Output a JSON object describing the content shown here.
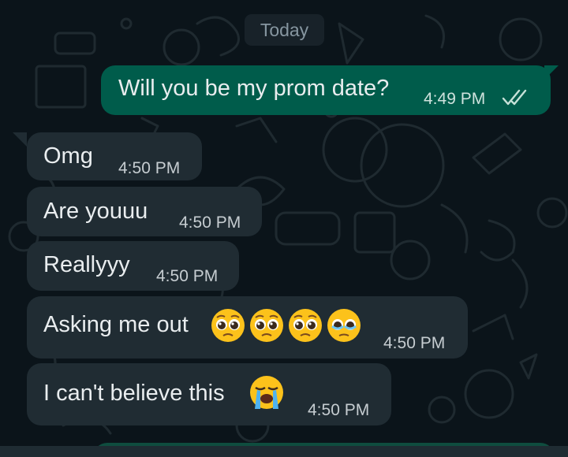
{
  "date_chip": "Today",
  "messages": [
    {
      "direction": "outgoing",
      "text": "Will you be my prom date?",
      "time": "4:49 PM",
      "status": "read"
    },
    {
      "direction": "incoming",
      "text": "Omg",
      "time": "4:50 PM"
    },
    {
      "direction": "incoming",
      "text": "Are youuu",
      "time": "4:50 PM"
    },
    {
      "direction": "incoming",
      "text": "Reallyyy",
      "time": "4:50 PM"
    },
    {
      "direction": "incoming",
      "text": "Asking me out",
      "emojis": [
        "pleading-face-emoji",
        "pleading-face-emoji",
        "pleading-face-emoji",
        "face-holding-back-tears-emoji"
      ],
      "time": "4:50 PM"
    },
    {
      "direction": "incoming",
      "text": "I can't believe this",
      "emojis": [
        "loudly-crying-face-emoji"
      ],
      "time": "4:50 PM"
    }
  ],
  "colors": {
    "background": "#0b141a",
    "outgoing_bubble": "#005c4b",
    "incoming_bubble": "#202c33",
    "date_chip": "#182229",
    "text": "#e9edef"
  }
}
